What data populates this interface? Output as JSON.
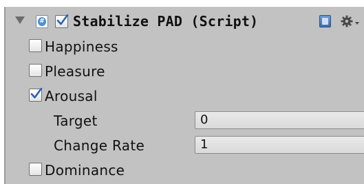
{
  "component": {
    "title": "Stabilize PAD (Script)",
    "enabled": true,
    "expanded": true,
    "icons": {
      "foldout": "foldout-arrow-icon",
      "script": "csharp-script-icon",
      "help": "help-book-icon",
      "settings": "gear-icon"
    }
  },
  "properties": [
    {
      "label": "Happiness",
      "checked": false
    },
    {
      "label": "Pleasure",
      "checked": false
    },
    {
      "label": "Arousal",
      "checked": true
    },
    {
      "label": "Dominance",
      "checked": false
    }
  ],
  "arousal_fields": [
    {
      "label": "Target",
      "value": "0"
    },
    {
      "label": "Change Rate",
      "value": "1"
    }
  ],
  "colors": {
    "panel_bg": "#c2c2c2",
    "field_bg": "#e0e0e0",
    "text": "#111111"
  }
}
